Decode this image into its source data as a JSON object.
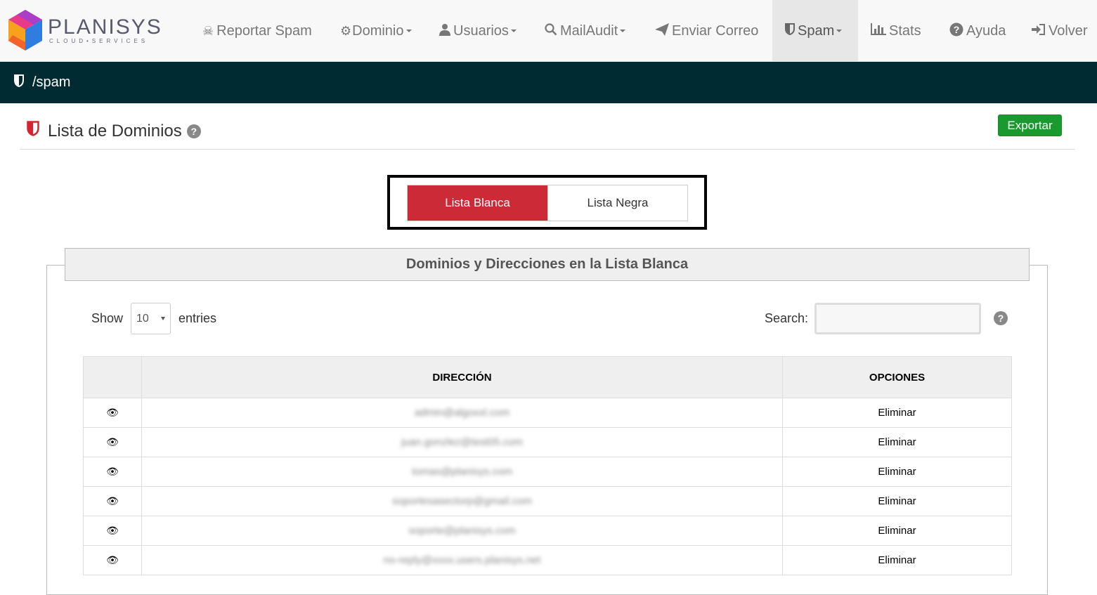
{
  "brand": {
    "name": "PLANISYS",
    "tagline": "CLOUD•SERVICES"
  },
  "nav": [
    {
      "label": "Reportar Spam",
      "icon": "skull-icon",
      "dropdown": false,
      "active": false
    },
    {
      "label": "Dominio",
      "icon": "gear-icon",
      "dropdown": true,
      "active": false
    },
    {
      "label": "Usuarios",
      "icon": "user-icon",
      "dropdown": true,
      "active": false
    },
    {
      "label": "MailAudit",
      "icon": "search-icon",
      "dropdown": true,
      "active": false
    },
    {
      "label": "Enviar Correo",
      "icon": "send-icon",
      "dropdown": false,
      "active": false
    },
    {
      "label": "Spam",
      "icon": "shield-icon",
      "dropdown": true,
      "active": true
    },
    {
      "label": "Stats",
      "icon": "bar-chart-icon",
      "dropdown": false,
      "active": false
    },
    {
      "label": "Ayuda",
      "icon": "question-icon",
      "dropdown": false,
      "active": false
    },
    {
      "label": "Volver",
      "icon": "sign-in-icon",
      "dropdown": false,
      "active": false
    }
  ],
  "breadcrumb": "/spam",
  "page": {
    "title": "Lista de Dominios",
    "export_label": "Exportar"
  },
  "toggle": {
    "white_label": "Lista Blanca",
    "black_label": "Lista Negra",
    "selected": "white"
  },
  "panel": {
    "title": "Dominios y Direcciones en la Lista Blanca",
    "show_label": "Show",
    "entries_label": "entries",
    "page_size": "10",
    "search_label": "Search:",
    "search_value": ""
  },
  "table": {
    "headers": [
      "",
      "DIRECCIÓN",
      "OPCIONES"
    ],
    "rows": [
      {
        "address": "admin@algoxxl.com",
        "action": "Eliminar"
      },
      {
        "address": "juan.gonzlez@test05.com",
        "action": "Eliminar"
      },
      {
        "address": "tomas@planisys.com",
        "action": "Eliminar"
      },
      {
        "address": "soportesasectorp@gmail.com",
        "action": "Eliminar"
      },
      {
        "address": "soporte@planisys.com",
        "action": "Eliminar"
      },
      {
        "address": "no-reply@xxxx.users.planisys.net",
        "action": "Eliminar"
      }
    ]
  },
  "colors": {
    "accent_red": "#cc2a36",
    "export_green": "#1a9a2e",
    "crumb_bg": "#002b33"
  }
}
